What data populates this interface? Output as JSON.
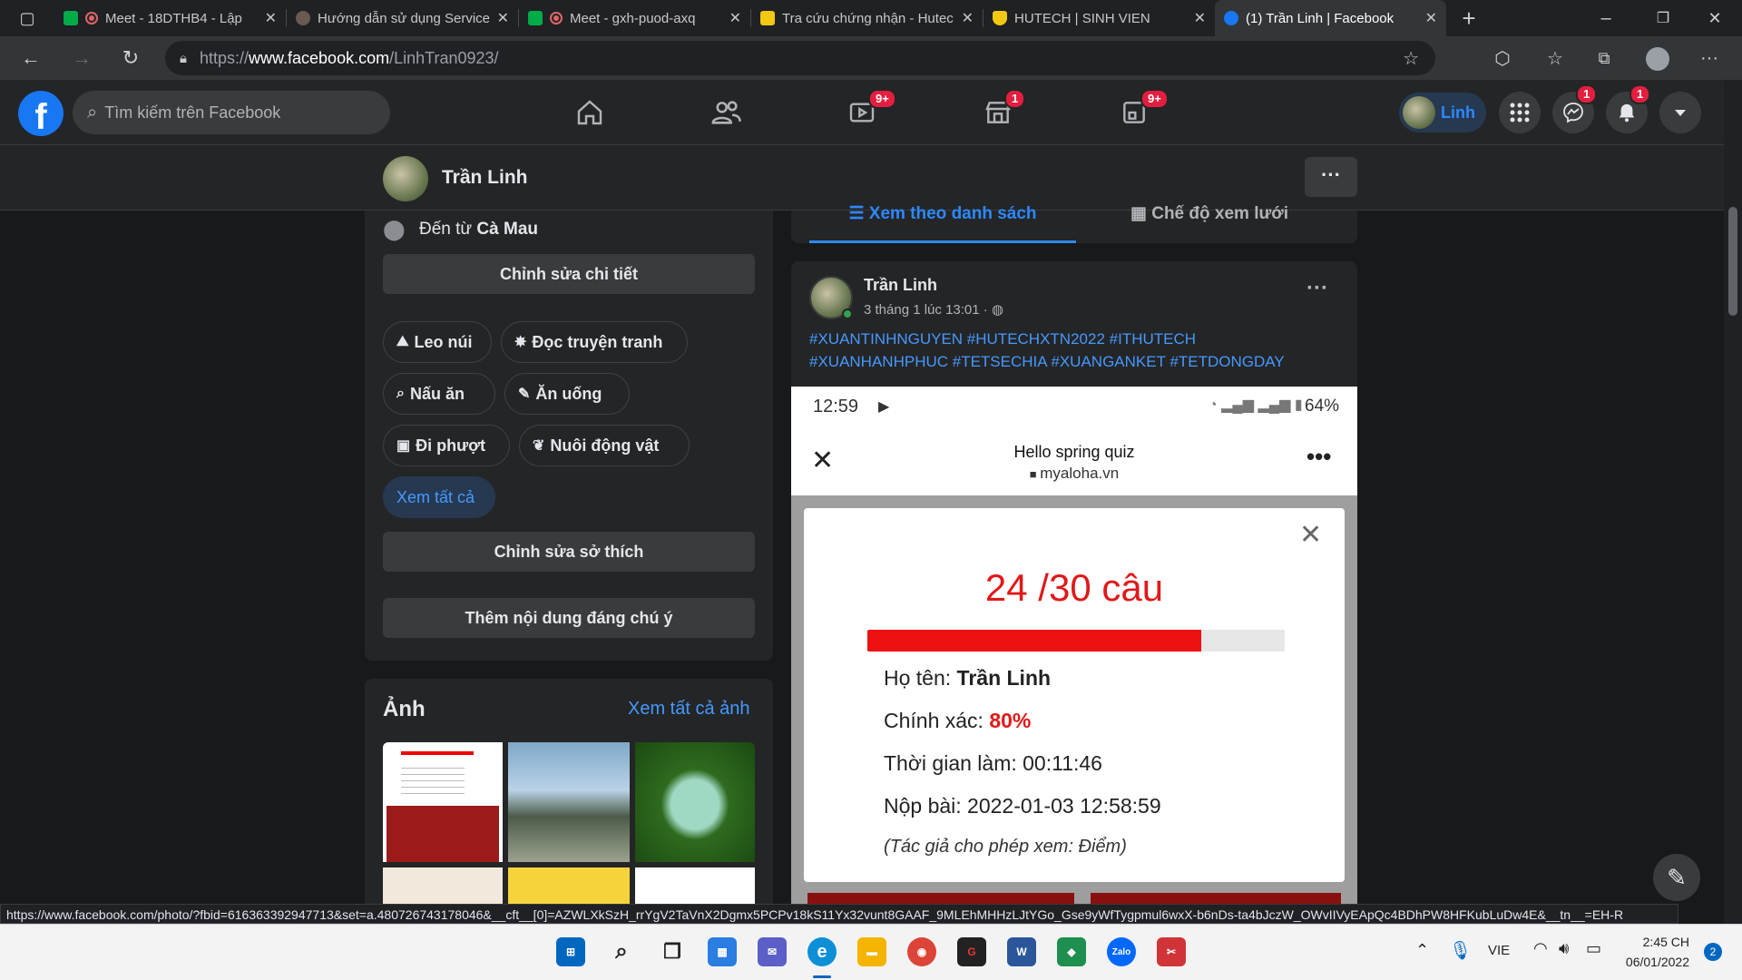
{
  "browser": {
    "tabs": [
      {
        "label": "Meet - 18DTHB4 - Lập",
        "icon_color": "#00ac47",
        "recording": true
      },
      {
        "label": "Hướng dẫn sử dụng Service",
        "icon_color": "#6b5a52",
        "recording": false
      },
      {
        "label": "Meet - gxh-puod-axq",
        "icon_color": "#00ac47",
        "recording": true
      },
      {
        "label": "Tra cứu chứng nhận - Hutec",
        "icon_color": "#f2c811",
        "recording": false
      },
      {
        "label": "HUTECH | SINH VIEN",
        "icon_color": "#f2c811",
        "recording": false
      },
      {
        "label": "(1) Trần Linh | Facebook",
        "icon_color": "#1877f2",
        "recording": false
      }
    ],
    "url_prefix": "https://",
    "url_domain": "www.facebook.com",
    "url_path": "/LinhTran0923/"
  },
  "fb": {
    "logo": "f",
    "search_placeholder": "Tìm kiếm trên Facebook",
    "badges": {
      "watch": "9+",
      "marketplace": "1",
      "gaming": "9+",
      "messenger": "1",
      "notifications": "1"
    },
    "profile_name": "Linh"
  },
  "profile_bar": {
    "name": "Trần Linh",
    "more": "···"
  },
  "intro": {
    "hometown_prefix": "Đến từ ",
    "hometown": "Cà Mau",
    "edit_details": "Chỉnh sửa chi tiết",
    "hobbies": [
      {
        "icon": "⛰",
        "label": "Leo núi"
      },
      {
        "icon": "✸",
        "label": "Đọc truyện tranh"
      },
      {
        "icon": "⌕",
        "label": "Nấu ăn"
      },
      {
        "icon": "✎",
        "label": "Ăn uống"
      },
      {
        "icon": "▣",
        "label": "Đi phượt"
      },
      {
        "icon": "❦",
        "label": "Nuôi động vật"
      }
    ],
    "see_all": "Xem tất cả",
    "edit_hobbies": "Chỉnh sửa sở thích",
    "add_featured": "Thêm nội dung đáng chú ý"
  },
  "photos": {
    "title": "Ảnh",
    "see_all": "Xem tất cả ảnh"
  },
  "view_tabs": {
    "list": "Xem theo danh sách",
    "grid": "Chế độ xem lưới"
  },
  "post": {
    "author": "Trần Linh",
    "time": "3 tháng 1 lúc 13:01 ·",
    "hashtags_line1": "#XUANTINHNGUYEN #HUTECHXTN2022 #ITHUTECH",
    "hashtags_line2": "#XUANHANHPHUC #TETSECHIA  #XUANGANKET #TETDONGDAY",
    "phone": {
      "time": "12:59",
      "battery": "64%",
      "page_title": "Hello spring quiz",
      "page_domain": "myaloha.vn",
      "score": "24 /30 câu",
      "progress": 0.8,
      "name_label": "Họ tên: ",
      "name_value": "Trần Linh",
      "accuracy_label": "Chính xác: ",
      "accuracy_value": "80%",
      "duration": "Thời gian làm: 00:11:46",
      "submitted": "Nộp bài: 2022-01-03 12:58:59",
      "note": "(Tác giả cho phép xem: Điểm)"
    }
  },
  "status_url": "https://www.facebook.com/photo/?fbid=616363392947713&set=a.480726743178046&__cft__[0]=AZWLXkSzH_rrYgV2TaVnX2Dgmx5PCPv18kS11Yx32vunt8GAAF_9MLEhMHHzLJtYGo_Gse9yWfTygpmul6wxX-b6nDs-ta4bJczW_OWvIIVyEApQc4BDhPW8HFKubLuDw4E&__tn__=EH-R",
  "taskbar": {
    "lang": "VIE",
    "time": "2:45 CH",
    "date": "06/01/2022",
    "notifications": "2",
    "apps": [
      {
        "name": "start-icon",
        "color": "#0067c0",
        "glyph": "⊞"
      },
      {
        "name": "search-icon",
        "color": "#f3f3f3",
        "glyph": "⌕"
      },
      {
        "name": "task-view-icon",
        "color": "#f3f3f3",
        "glyph": "❐"
      },
      {
        "name": "widgets-icon",
        "color": "#2a7de1",
        "glyph": "▦"
      },
      {
        "name": "teams-chat-icon",
        "color": "#5b5fc7",
        "glyph": "✉"
      },
      {
        "name": "edge-icon",
        "color": "#0c8fd6",
        "glyph": "e"
      },
      {
        "name": "file-explorer-icon",
        "color": "#f4b400",
        "glyph": "▬"
      },
      {
        "name": "chrome-icon",
        "color": "#db4437",
        "glyph": "◉"
      },
      {
        "name": "garena-icon",
        "color": "#222222",
        "glyph": "G"
      },
      {
        "name": "word-icon",
        "color": "#2b579a",
        "glyph": "W"
      },
      {
        "name": "vpn-icon",
        "color": "#1e8f4e",
        "glyph": "◆"
      },
      {
        "name": "zalo-icon",
        "color": "#0068ff",
        "glyph": "Zalo"
      },
      {
        "name": "snipping-tool-icon",
        "color": "#d13438",
        "glyph": "✂"
      }
    ]
  }
}
